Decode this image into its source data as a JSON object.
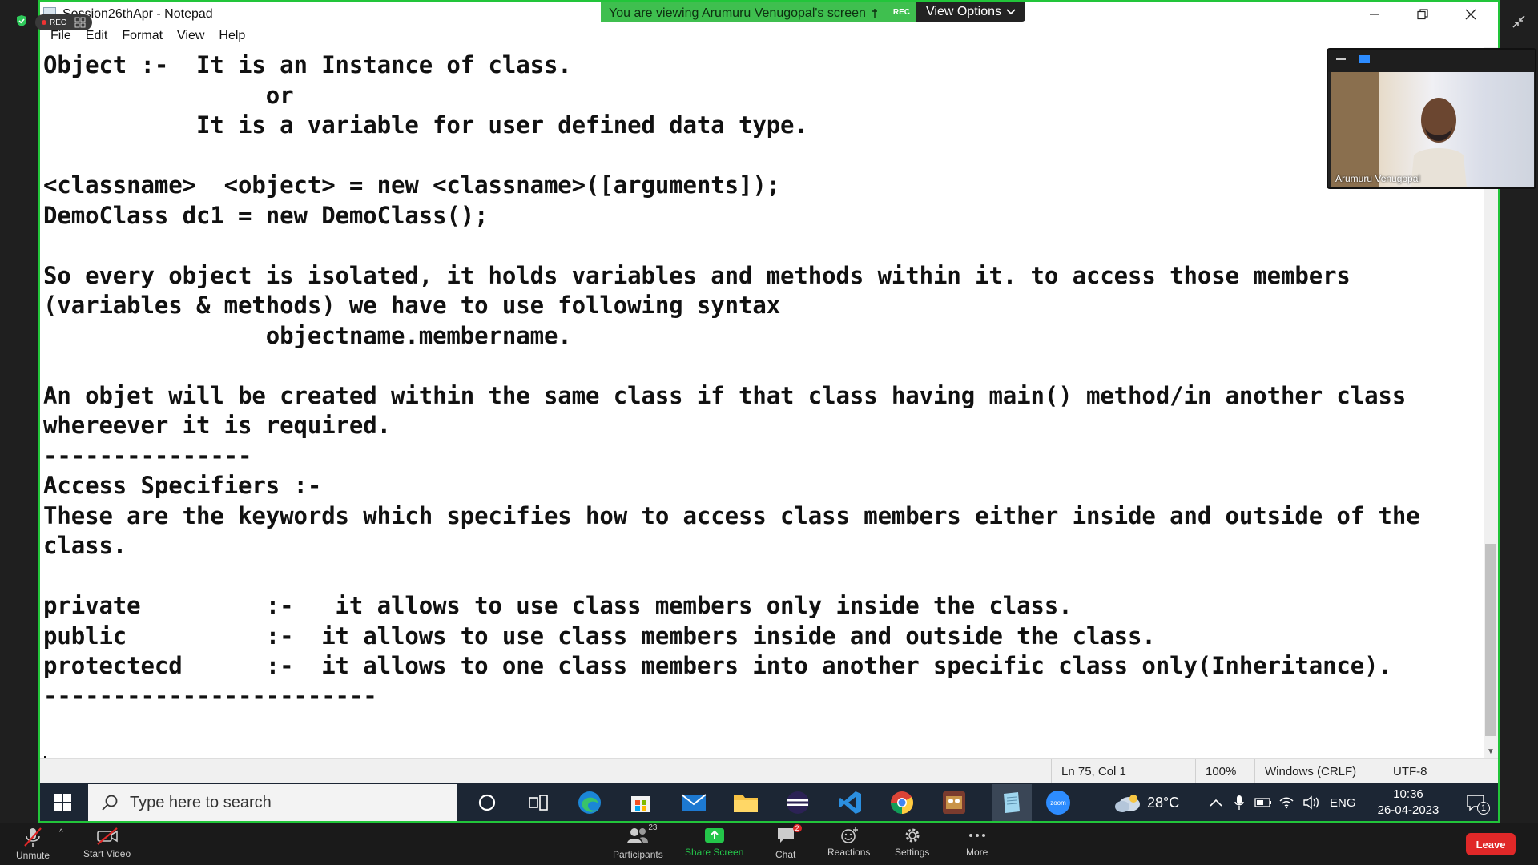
{
  "notepad": {
    "title": "Session26thApr - Notepad",
    "menu": [
      "File",
      "Edit",
      "Format",
      "View",
      "Help"
    ],
    "content": "Object :-  It is an Instance of class.\n                or\n           It is a variable for user defined data type.\n\n<classname>  <object> = new <classname>([arguments]);\nDemoClass dc1 = new DemoClass();\n\nSo every object is isolated, it holds variables and methods within it. to access those members\n(variables & methods) we have to use following syntax\n                objectname.membername.\n\nAn objet will be created within the same class if that class having main() method/in another class\nwhereever it is required.\n---------------\nAccess Specifiers :-\nThese are the keywords which specifies how to access class members either inside and outside of the\nclass.\n\nprivate         :-   it allows to use class members only inside the class.\npublic          :-  it allows to use class members inside and outside the class.\nprotectecd      :-  it allows to one class members into another specific class only(Inheritance).\n------------------------",
    "status": {
      "position": "Ln 75, Col 1",
      "zoom": "100%",
      "line_ending": "Windows (CRLF)",
      "encoding": "UTF-8"
    }
  },
  "share_banner": {
    "text": "You are viewing Arumuru Venugopal's screen",
    "rec": "REC",
    "view_options": "View Options"
  },
  "rec_pill": "REC",
  "video": {
    "name": "Arumuru Venugopal"
  },
  "taskbar": {
    "search_placeholder": "Type here to search",
    "weather": "28°C",
    "language": "ENG",
    "time": "10:36",
    "date": "26-04-2023",
    "notification_count": "1"
  },
  "zoom_controls": {
    "unmute": "Unmute",
    "start_video": "Start Video",
    "participants": "Participants",
    "participants_count": "23",
    "share_screen": "Share Screen",
    "chat": "Chat",
    "chat_badge": "2",
    "reactions": "Reactions",
    "settings": "Settings",
    "more": "More",
    "leave": "Leave"
  },
  "colors": {
    "share_border": "#22c53a",
    "leave": "#e02828",
    "share_screen_accent": "#24c64a"
  }
}
